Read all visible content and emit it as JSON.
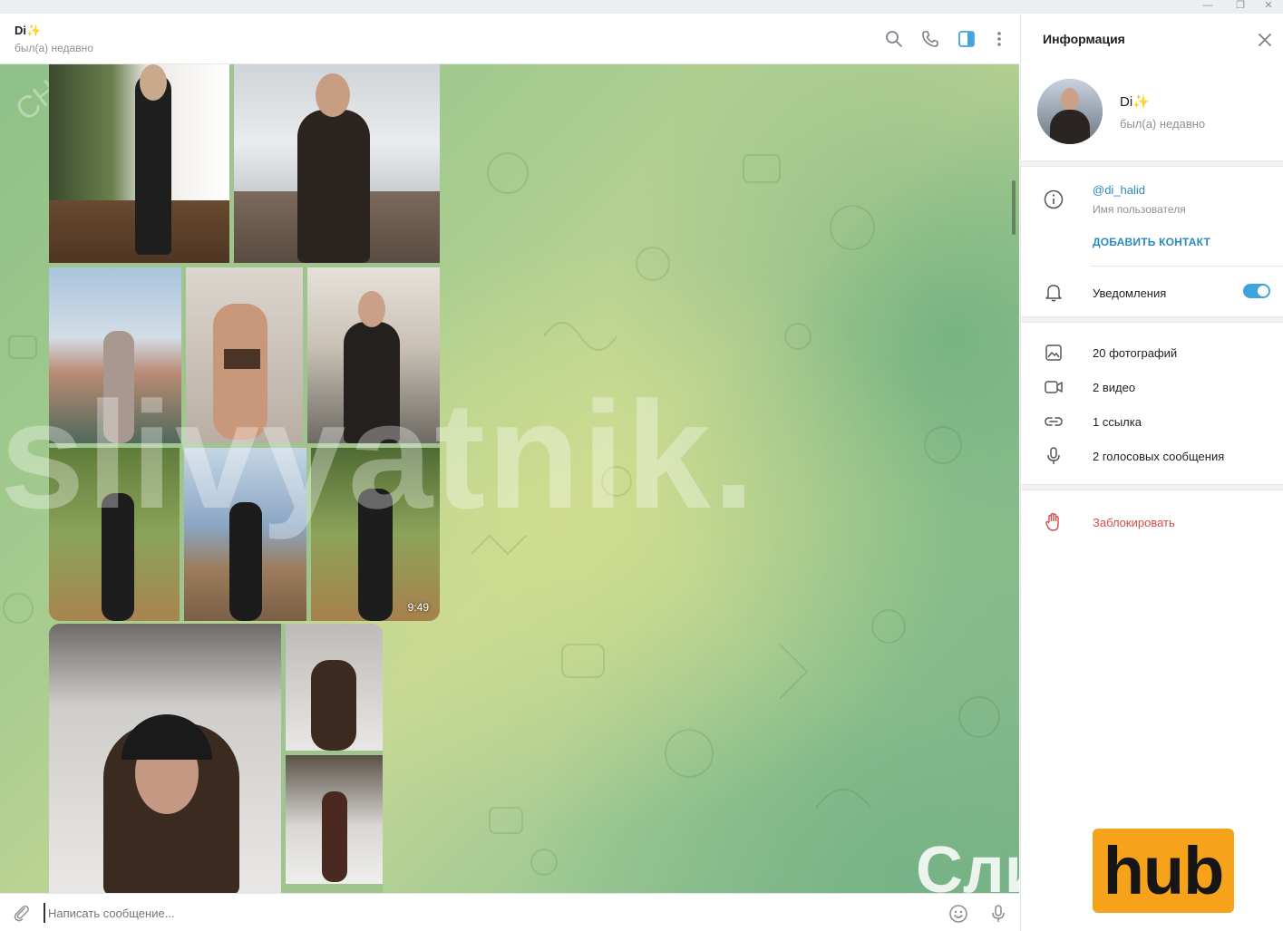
{
  "window": {
    "minimize": "—",
    "maximize": "❐",
    "close": "✕"
  },
  "chat": {
    "name": "Di✨",
    "status": "был(а) недавно"
  },
  "header_icons": [
    "search-icon",
    "phone-icon",
    "sidebar-toggle-icon",
    "more-vert-icon"
  ],
  "album": {
    "video_duration": "9:49"
  },
  "watermarks": {
    "big": "slivyatnik.",
    "corner": "Сли",
    "diag": "CHECKYOU.ME"
  },
  "composer": {
    "placeholder": "Написать сообщение..."
  },
  "info_panel": {
    "title": "Информация",
    "name": "Di✨",
    "status": "был(а) недавно",
    "username": "@di_halid",
    "username_hint": "Имя пользователя",
    "add_contact": "ДОБАВИТЬ КОНТАКТ",
    "notifications": "Уведомления",
    "notifications_on": true,
    "media": [
      {
        "icon": "photo-icon",
        "label": "20 фотографий"
      },
      {
        "icon": "video-icon",
        "label": "2 видео"
      },
      {
        "icon": "link-icon",
        "label": "1 ссылка"
      },
      {
        "icon": "mic-icon",
        "label": "2 голосовых сообщения"
      }
    ],
    "block": "Заблокировать"
  },
  "hub_logo": "hub",
  "colors": {
    "accent": "#3fa3e0",
    "link": "#2a8ac0",
    "danger": "#d14e4e",
    "hub": "#f7a21b"
  }
}
